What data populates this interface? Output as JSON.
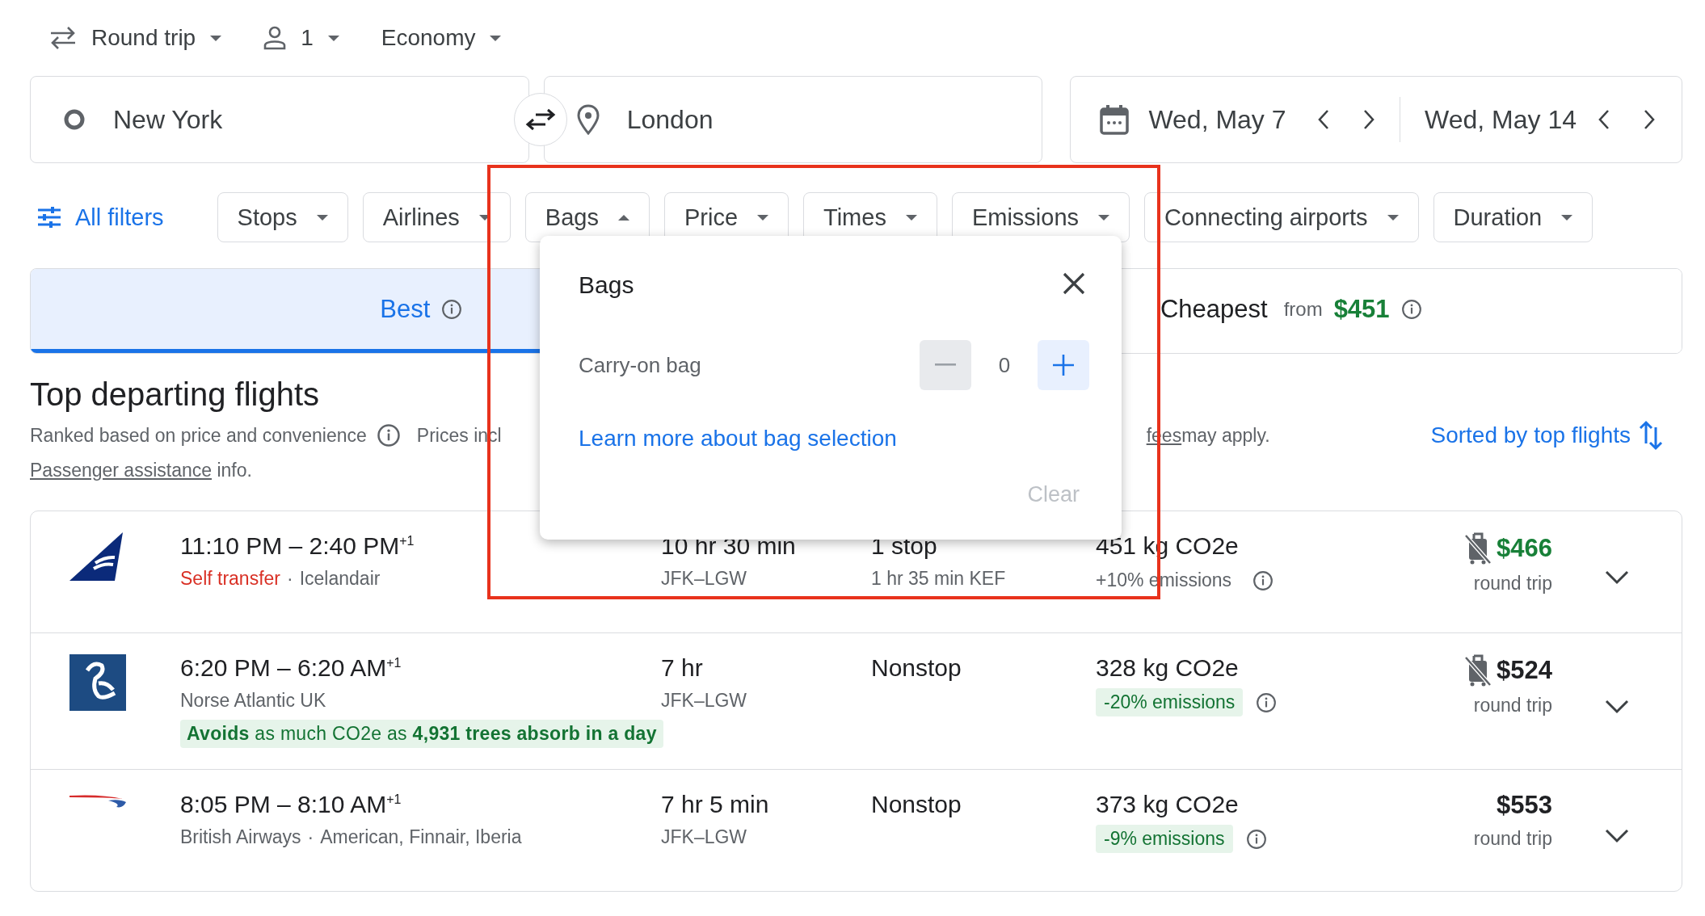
{
  "trip_options": [
    {
      "kind": "trip_type",
      "label": "Round trip"
    },
    {
      "kind": "passengers",
      "label": "1"
    },
    {
      "kind": "cabin",
      "label": "Economy"
    }
  ],
  "search": {
    "origin": "New York",
    "destination": "London",
    "depart_date": "Wed, May 7",
    "return_date": "Wed, May 14"
  },
  "filters": {
    "all_filters": "All filters",
    "chips": [
      {
        "label": "Stops",
        "expanded": false
      },
      {
        "label": "Airlines",
        "expanded": false
      },
      {
        "label": "Bags",
        "expanded": true
      },
      {
        "label": "Price",
        "expanded": false
      },
      {
        "label": "Times",
        "expanded": false
      },
      {
        "label": "Emissions",
        "expanded": false
      },
      {
        "label": "Connecting airports",
        "expanded": false
      },
      {
        "label": "Duration",
        "expanded": false
      }
    ]
  },
  "tabs": [
    {
      "label": "Best",
      "selected": true
    },
    {
      "label": "Cheapest",
      "prefix": "from",
      "price": "$451",
      "selected": false
    }
  ],
  "results": {
    "title": "Top departing flights",
    "ranking_note": "Ranked based on price and convenience",
    "prices_note_start": "Prices incl",
    "fees_link": "fees",
    "prices_note_end": "may apply.",
    "assistance_link": "Passenger assistance",
    "assistance_suffix": "info.",
    "sort": "Sorted by top flights"
  },
  "flights": [
    {
      "logo": {
        "kind": "tail"
      },
      "times": "11:10 PM – 2:40 PM",
      "day_offset": "+1",
      "warning": "Self transfer",
      "separator": "·",
      "airlines": [
        "Icelandair"
      ],
      "duration": "10 hr 30 min",
      "route": "JFK–LGW",
      "stops": "1 stop",
      "layover": "1 hr 35 min KEF",
      "emissions": "451 kg CO2e",
      "emissions_change": {
        "text": "+10% emissions",
        "kind": "higher"
      },
      "no_carry_on": true,
      "price": "$466",
      "price_low": true,
      "price_note": "round trip"
    },
    {
      "logo": {
        "kind": "swirl"
      },
      "times": "6:20 PM – 6:20 AM",
      "day_offset": "+1",
      "airlines": [
        "Norse Atlantic UK"
      ],
      "eco_note": "**Avoids** as much CO2e as **4,931 trees absorb in a day**",
      "duration": "7 hr",
      "route": "JFK–LGW",
      "stops": "Nonstop",
      "emissions": "328 kg CO2e",
      "emissions_change": {
        "text": "-20% emissions",
        "kind": "lower"
      },
      "no_carry_on": true,
      "price": "$524",
      "price_low": false,
      "price_note": "round trip"
    },
    {
      "logo": {
        "kind": "swoosh"
      },
      "times": "8:05 PM – 8:10 AM",
      "day_offset": "+1",
      "separator": "·",
      "airlines": [
        "British Airways",
        "American, Finnair, Iberia"
      ],
      "duration": "7 hr 5 min",
      "route": "JFK–LGW",
      "stops": "Nonstop",
      "emissions": "373 kg CO2e",
      "emissions_change": {
        "text": "-9% emissions",
        "kind": "lower"
      },
      "no_carry_on": false,
      "price": "$553",
      "price_low": false,
      "price_note": "round trip"
    }
  ],
  "bags_popup": {
    "title": "Bags",
    "carry_on": {
      "label": "Carry-on bag",
      "value": "0",
      "decrement_disabled": true
    },
    "link": "Learn more about bag selection",
    "clear": "Clear",
    "clear_disabled": true
  }
}
